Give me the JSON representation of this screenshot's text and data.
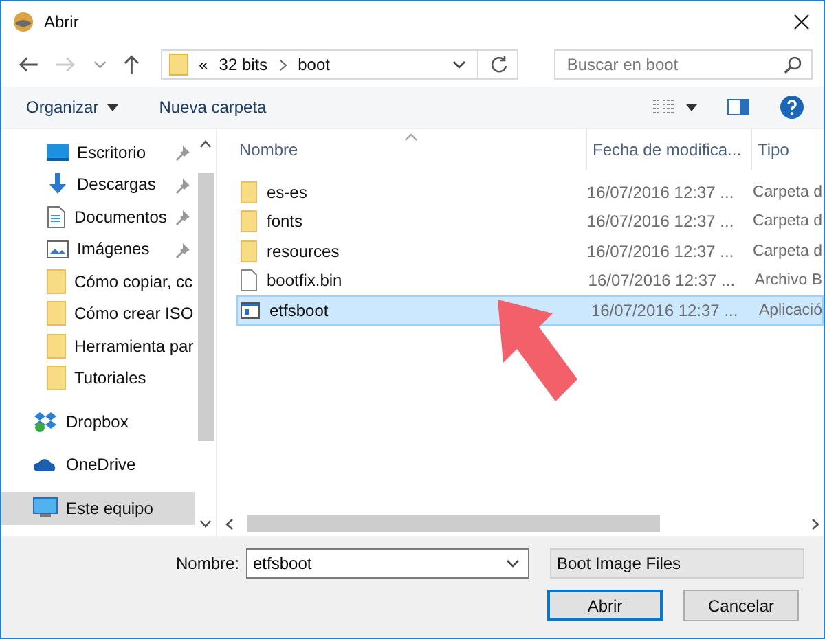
{
  "window": {
    "title": "Abrir"
  },
  "address": {
    "overflow": "«",
    "segments": [
      "32 bits",
      "boot"
    ]
  },
  "search": {
    "placeholder": "Buscar en boot"
  },
  "toolbar": {
    "organize": "Organizar",
    "new_folder": "Nueva carpeta"
  },
  "sidebar": {
    "items": [
      {
        "label": "Escritorio",
        "kind": "desktop",
        "pinned": true,
        "selected": false
      },
      {
        "label": "Descargas",
        "kind": "download",
        "pinned": true,
        "selected": false
      },
      {
        "label": "Documentos",
        "kind": "document",
        "pinned": true,
        "selected": false
      },
      {
        "label": "Imágenes",
        "kind": "image",
        "pinned": true,
        "selected": false
      },
      {
        "label": "Cómo copiar, cc",
        "kind": "folder",
        "pinned": false,
        "selected": false
      },
      {
        "label": "Cómo crear ISO",
        "kind": "folder",
        "pinned": false,
        "selected": false
      },
      {
        "label": "Herramienta par",
        "kind": "folder",
        "pinned": false,
        "selected": false
      },
      {
        "label": "Tutoriales",
        "kind": "folder",
        "pinned": false,
        "selected": false
      },
      {
        "label": "Dropbox",
        "kind": "dropbox",
        "pinned": false,
        "selected": false
      },
      {
        "label": "OneDrive",
        "kind": "onedrive",
        "pinned": false,
        "selected": false
      },
      {
        "label": "Este equipo",
        "kind": "computer",
        "pinned": false,
        "selected": true
      }
    ]
  },
  "table": {
    "columns": [
      "Nombre",
      "Fecha de modifica...",
      "Tipo"
    ],
    "rows": [
      {
        "kind": "folder",
        "name": "es-es",
        "date": "16/07/2016 12:37 ...",
        "type": "Carpeta d",
        "selected": false
      },
      {
        "kind": "folder",
        "name": "fonts",
        "date": "16/07/2016 12:37 ...",
        "type": "Carpeta d",
        "selected": false
      },
      {
        "kind": "folder",
        "name": "resources",
        "date": "16/07/2016 12:37 ...",
        "type": "Carpeta d",
        "selected": false
      },
      {
        "kind": "file",
        "name": "bootfix.bin",
        "date": "16/07/2016 12:37 ...",
        "type": "Archivo B",
        "selected": false
      },
      {
        "kind": "app",
        "name": "etfsboot",
        "date": "16/07/2016 12:37 ...",
        "type": "Aplicació",
        "selected": true
      }
    ]
  },
  "footer": {
    "name_label": "Nombre:",
    "name_value": "etfsboot",
    "filter": "Boot Image Files",
    "open": "Abrir",
    "cancel": "Cancelar"
  }
}
